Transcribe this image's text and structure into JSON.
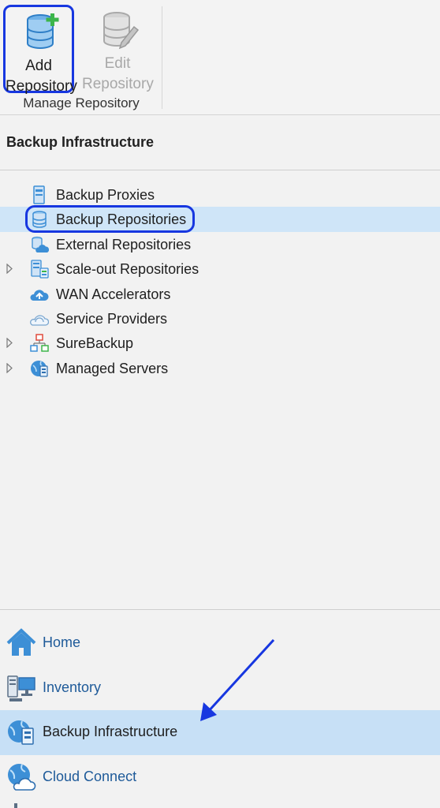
{
  "ribbon": {
    "add_repository": "Add\nRepository",
    "add_line1": "Add",
    "add_line2": "Repository",
    "edit_line1": "Edit",
    "edit_line2": "Repository",
    "group_label": "Manage Repository"
  },
  "section_title": "Backup Infrastructure",
  "tree": {
    "items": [
      {
        "label": "Backup Proxies",
        "icon": "proxy-icon",
        "expandable": false
      },
      {
        "label": "Backup Repositories",
        "icon": "repository-icon",
        "expandable": false,
        "selected": true
      },
      {
        "label": "External Repositories",
        "icon": "external-repository-icon",
        "expandable": false
      },
      {
        "label": "Scale-out Repositories",
        "icon": "scale-out-repository-icon",
        "expandable": true
      },
      {
        "label": "WAN Accelerators",
        "icon": "wan-accelerator-icon",
        "expandable": false
      },
      {
        "label": "Service Providers",
        "icon": "service-provider-icon",
        "expandable": false
      },
      {
        "label": "SureBackup",
        "icon": "surebackup-icon",
        "expandable": true
      },
      {
        "label": "Managed Servers",
        "icon": "managed-servers-icon",
        "expandable": true
      }
    ]
  },
  "nav": {
    "items": [
      {
        "label": "Home",
        "icon": "home-icon"
      },
      {
        "label": "Inventory",
        "icon": "inventory-icon"
      },
      {
        "label": "Backup Infrastructure",
        "icon": "backup-infrastructure-icon",
        "active": true
      },
      {
        "label": "Cloud Connect",
        "icon": "cloud-connect-icon"
      }
    ]
  },
  "colors": {
    "highlight_ring": "#1737e0",
    "selected_bg": "#cfe5f8",
    "nav_text": "#1e5a99",
    "icon_blue": "#3d8fd6"
  }
}
